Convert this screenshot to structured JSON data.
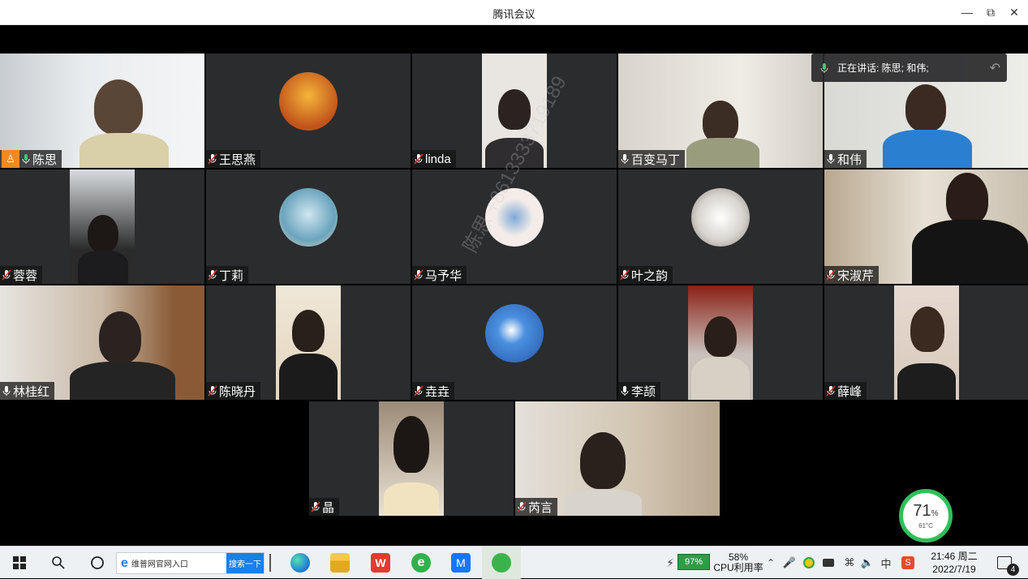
{
  "window": {
    "title": "腾讯会议"
  },
  "speaking": {
    "text": "正在讲话: 陈思; 和伟;"
  },
  "watermark": {
    "text": "陈思 +8613333719189"
  },
  "participants": [
    {
      "name": "陈思"
    },
    {
      "name": "王思燕"
    },
    {
      "name": "linda"
    },
    {
      "name": "百变马丁"
    },
    {
      "name": "和伟"
    },
    {
      "name": "蓉蓉"
    },
    {
      "name": "丁莉"
    },
    {
      "name": "马予华"
    },
    {
      "name": "叶之韵"
    },
    {
      "name": "宋淑芹"
    },
    {
      "name": "林桂红"
    },
    {
      "name": "陈晓丹"
    },
    {
      "name": "垚垚"
    },
    {
      "name": "李颉"
    },
    {
      "name": "薛峰"
    },
    {
      "name": "晶"
    },
    {
      "name": "芮言"
    }
  ],
  "gauge": {
    "percent": "71",
    "unit": "%",
    "temp": "61°C"
  },
  "taskbar": {
    "search_placeholder": "维普网官网入口",
    "search_button": "搜索一下",
    "battery": "97%",
    "cpu_value": "58%",
    "cpu_label": "CPU利用率",
    "time": "21:46 周二",
    "date": "2022/7/19",
    "notifications": "4"
  },
  "colors": {
    "accent": "#22b559",
    "tile_bg": "#2b2c2e",
    "search_btn": "#1a7fe8"
  }
}
